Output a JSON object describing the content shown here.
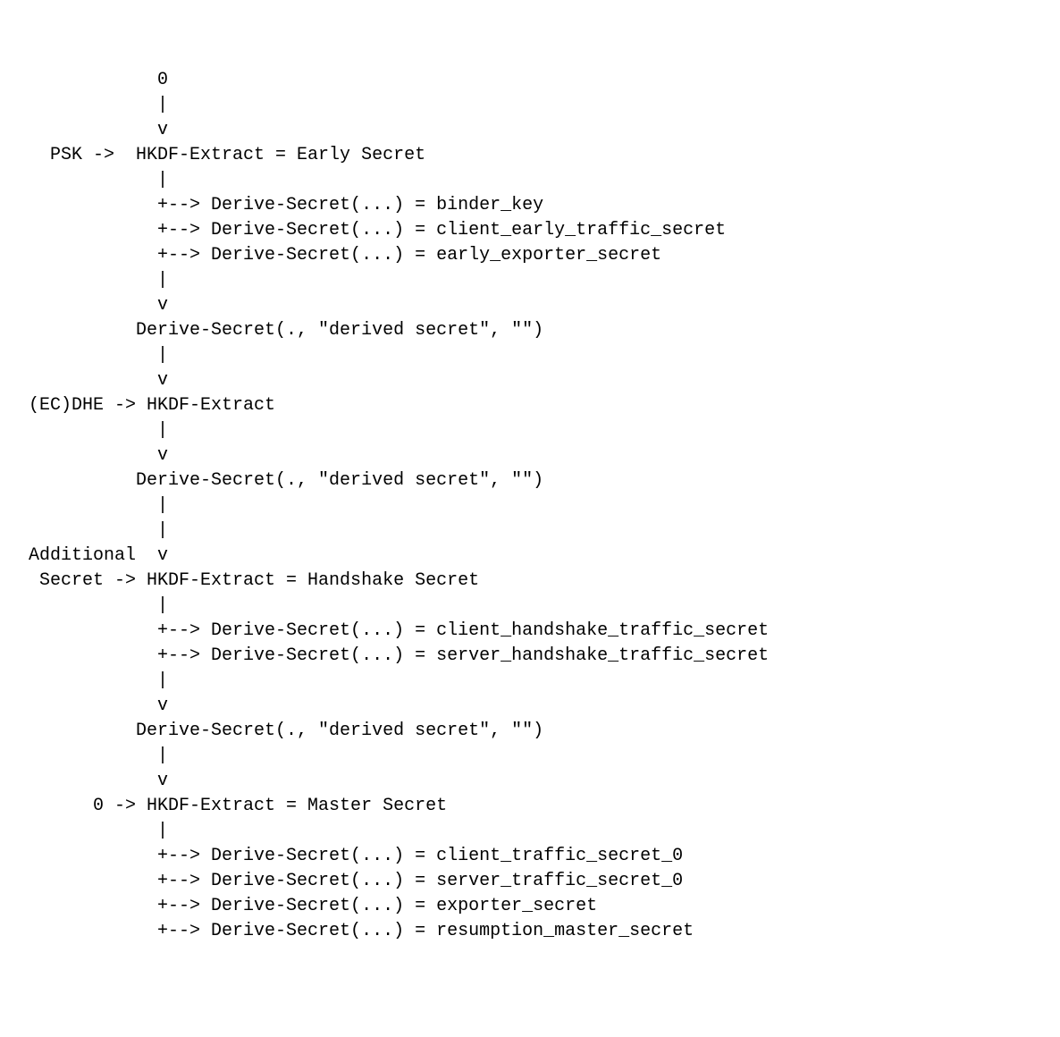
{
  "lines": [
    "             0",
    "             |",
    "             v",
    "   PSK ->  HKDF-Extract = Early Secret",
    "             |",
    "             +--> Derive-Secret(...) = binder_key",
    "             +--> Derive-Secret(...) = client_early_traffic_secret",
    "             +--> Derive-Secret(...) = early_exporter_secret",
    "             |",
    "             v",
    "           Derive-Secret(., \"derived secret\", \"\")",
    "             |",
    "             v",
    " (EC)DHE -> HKDF-Extract",
    "             |",
    "             v",
    "           Derive-Secret(., \"derived secret\", \"\")",
    "             |",
    "             |",
    " Additional  v",
    "  Secret -> HKDF-Extract = Handshake Secret",
    "             |",
    "             +--> Derive-Secret(...) = client_handshake_traffic_secret",
    "             +--> Derive-Secret(...) = server_handshake_traffic_secret",
    "             |",
    "             v",
    "           Derive-Secret(., \"derived secret\", \"\")",
    "             |",
    "             v",
    "       0 -> HKDF-Extract = Master Secret",
    "             |",
    "             +--> Derive-Secret(...) = client_traffic_secret_0",
    "             +--> Derive-Secret(...) = server_traffic_secret_0",
    "             +--> Derive-Secret(...) = exporter_secret",
    "             +--> Derive-Secret(...) = resumption_master_secret"
  ]
}
